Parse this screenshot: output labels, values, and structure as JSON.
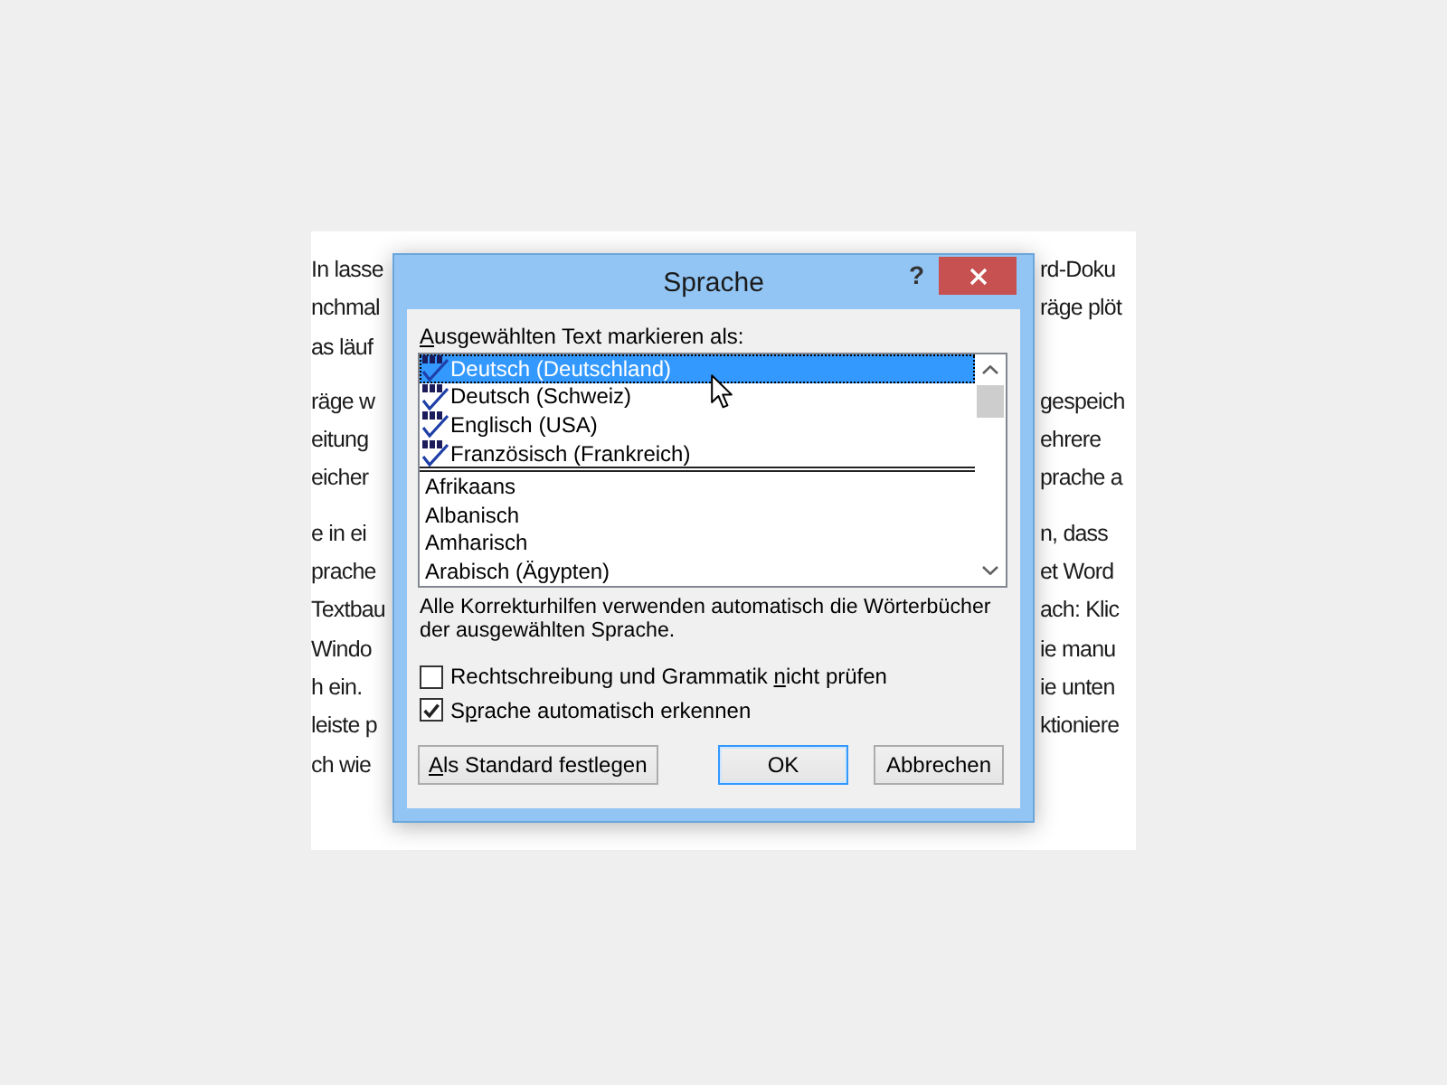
{
  "document": {
    "paragraphs": [
      {
        "lines": [
          {
            "left": "In lasse",
            "right": "rd-Doku"
          },
          {
            "left": "nchmal",
            "right": "räge plöt"
          },
          {
            "left": "as läuf"
          }
        ]
      },
      {
        "lines": [
          {
            "left": "räge w",
            "right": "gespeich"
          },
          {
            "left": "eitung",
            "right": "ehrere"
          },
          {
            "left": "eicher",
            "right": "prache a"
          }
        ]
      },
      {
        "lines": [
          {
            "left": "e in ei",
            "right": "n, dass"
          },
          {
            "left": "prache",
            "right": "et Word"
          },
          {
            "left": "Textbau",
            "right": "ach: Klic"
          },
          {
            "left": "Windo",
            "right": "ie manu"
          },
          {
            "left": "h ein.",
            "right": "ie unten"
          },
          {
            "left": "leiste p",
            "right": "ktioniere"
          },
          {
            "left": "ch wie"
          }
        ]
      }
    ]
  },
  "dialog": {
    "title": "Sprache",
    "help_button": "?",
    "list_label": [
      {
        "text": "A",
        "access_key": true
      },
      {
        "text": "usgewählten Text markieren als:",
        "access_key": false
      }
    ],
    "list": {
      "groups": [
        {
          "items": [
            {
              "label": "Deutsch (Deutschland)",
              "proofing": true,
              "selected": true
            },
            {
              "label": "Deutsch (Schweiz)",
              "proofing": true,
              "selected": false
            },
            {
              "label": "Englisch (USA)",
              "proofing": true,
              "selected": false
            },
            {
              "label": "Französisch (Frankreich)",
              "proofing": true,
              "selected": false
            }
          ]
        },
        {
          "items": [
            {
              "label": "Afrikaans",
              "proofing": false,
              "selected": false
            },
            {
              "label": "Albanisch",
              "proofing": false,
              "selected": false
            },
            {
              "label": "Amharisch",
              "proofing": false,
              "selected": false
            },
            {
              "label": "Arabisch (Ägypten)",
              "proofing": false,
              "selected": false
            }
          ]
        }
      ]
    },
    "description": "Alle Korrekturhilfen verwenden automatisch die Wörterbücher der ausgewählten Sprache.",
    "options": [
      {
        "label": [
          {
            "text": "Rechtschreibung und Grammatik ",
            "access_key": false
          },
          {
            "text": "n",
            "access_key": true
          },
          {
            "text": "icht prüfen",
            "access_key": false
          }
        ],
        "checked": false
      },
      {
        "label": [
          {
            "text": "S",
            "access_key": false
          },
          {
            "text": "p",
            "access_key": true
          },
          {
            "text": "rache automatisch erkennen",
            "access_key": false
          }
        ],
        "checked": true
      }
    ],
    "buttons": [
      {
        "label": [
          {
            "text": "A",
            "access_key": true
          },
          {
            "text": "ls Standard festlegen",
            "access_key": false
          }
        ],
        "default": false
      },
      {
        "label": [
          {
            "text": "OK",
            "access_key": false
          }
        ],
        "default": true
      },
      {
        "label": [
          {
            "text": "Abbrechen",
            "access_key": false
          }
        ],
        "default": false
      }
    ]
  }
}
